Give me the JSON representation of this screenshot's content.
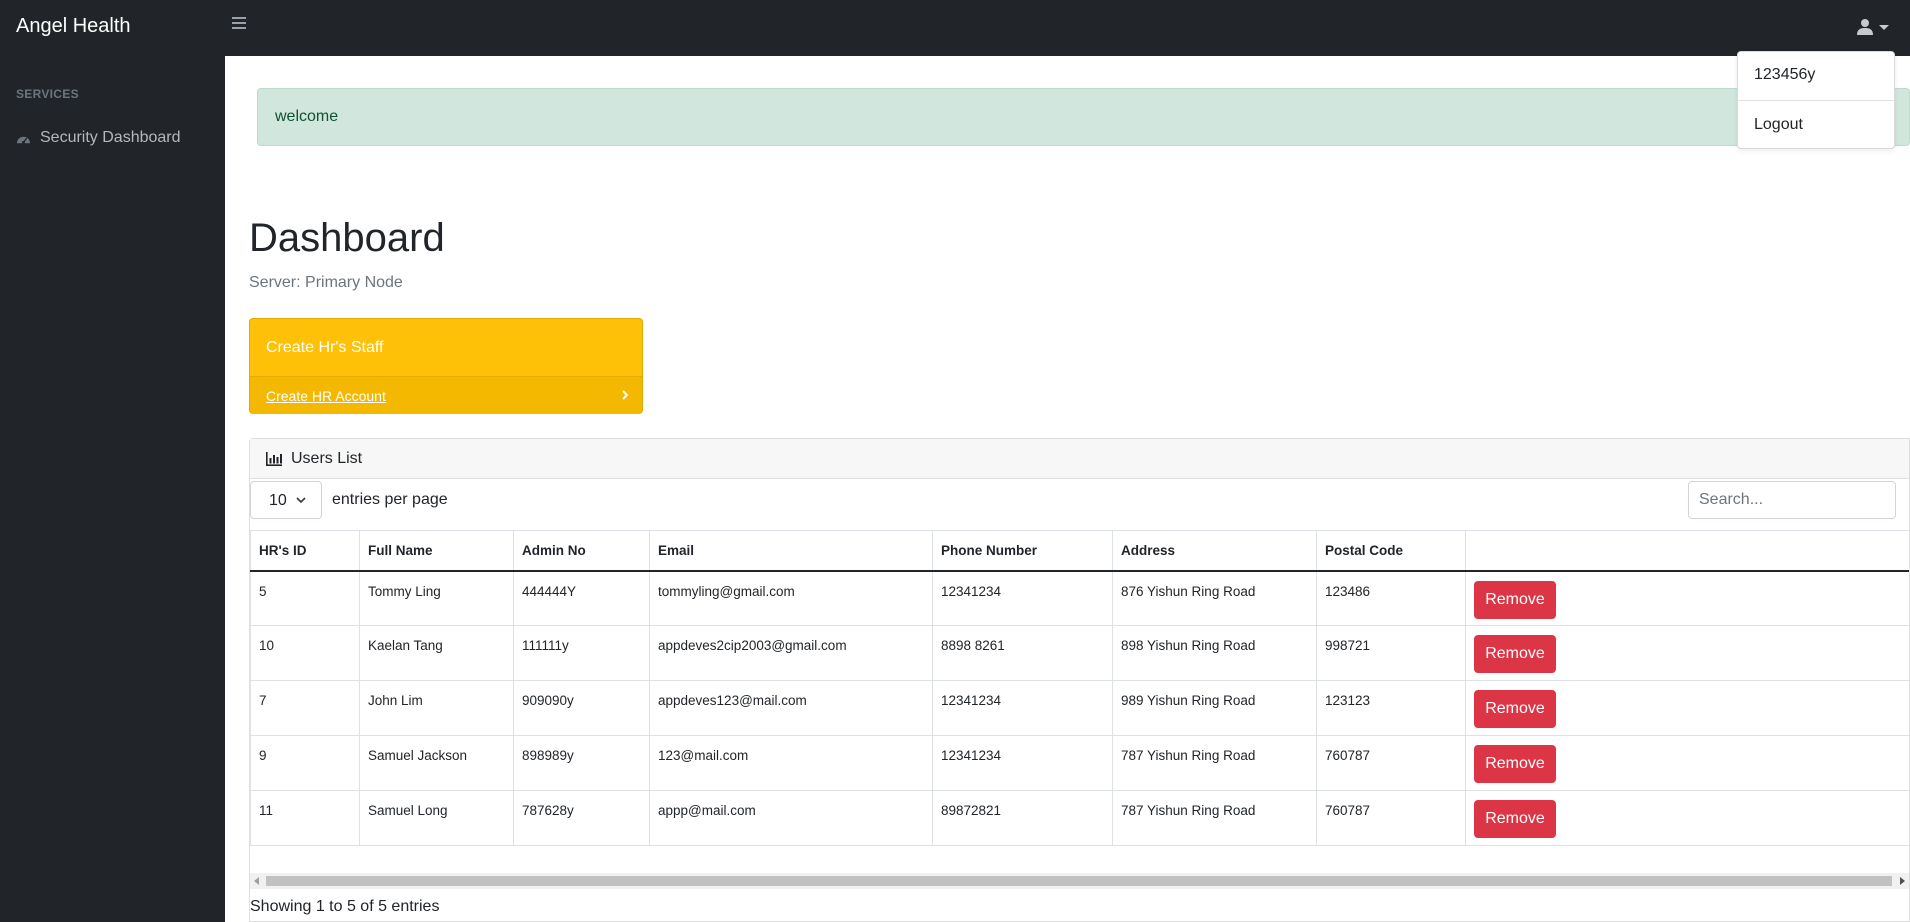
{
  "app": {
    "brand": "Angel Health"
  },
  "user_menu": {
    "items": [
      "123456y",
      "Logout"
    ]
  },
  "sidebar": {
    "heading": "SERVICES",
    "items": [
      {
        "label": "Security Dashboard",
        "icon": "tachometer-icon"
      }
    ]
  },
  "alert": {
    "text": "welcome"
  },
  "page": {
    "title": "Dashboard",
    "subtitle": "Server: Primary Node"
  },
  "hr_card": {
    "title": "Create Hr's Staff",
    "link": "Create HR Account"
  },
  "users_card": {
    "title": "Users List",
    "length_value": "10",
    "length_label": "entries per page",
    "search_placeholder": "Search...",
    "columns": [
      "HR's ID",
      "Full Name",
      "Admin No",
      "Email",
      "Phone Number",
      "Address",
      "Postal Code",
      ""
    ],
    "rows": [
      {
        "id": "5",
        "name": "Tommy Ling",
        "admin": "444444Y",
        "email": "tommyling@gmail.com",
        "phone": "12341234",
        "address": "876 Yishun Ring Road",
        "postal": "123486",
        "action": "Remove"
      },
      {
        "id": "10",
        "name": "Kaelan Tang",
        "admin": "111111y",
        "email": "appdeves2cip2003@gmail.com",
        "phone": "8898 8261",
        "address": "898 Yishun Ring Road",
        "postal": "998721",
        "action": "Remove"
      },
      {
        "id": "7",
        "name": "John Lim",
        "admin": "909090y",
        "email": "appdeves123@mail.com",
        "phone": "12341234",
        "address": "989 Yishun Ring Road",
        "postal": "123123",
        "action": "Remove"
      },
      {
        "id": "9",
        "name": "Samuel Jackson",
        "admin": "898989y",
        "email": "123@mail.com",
        "phone": "12341234",
        "address": "787 Yishun Ring Road",
        "postal": "760787",
        "action": "Remove"
      },
      {
        "id": "11",
        "name": "Samuel Long",
        "admin": "787628y",
        "email": "appp@mail.com",
        "phone": "89872821",
        "address": "787 Yishun Ring Road",
        "postal": "760787",
        "action": "Remove"
      }
    ],
    "info": "Showing 1 to 5 of 5 entries"
  },
  "colors": {
    "navbar": "#212529",
    "alert_bg": "#d1e7dd",
    "warning": "#ffc107",
    "danger": "#dc3545"
  }
}
